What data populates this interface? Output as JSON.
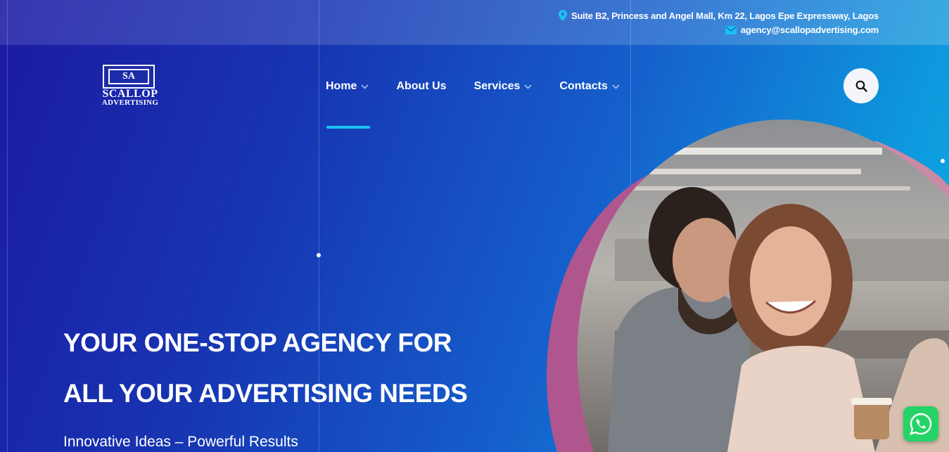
{
  "topbar": {
    "address": "Suite B2, Princess and Angel Mall, Km 22, Lagos Epe Expressway, Lagos",
    "email": "agency@scallopadvertising.com",
    "address_icon": "map-pin-icon",
    "email_icon": "envelope-icon"
  },
  "logo": {
    "line1": "SCALLOP",
    "line2": "ADVERTISING",
    "emblem": "SA"
  },
  "nav": {
    "items": [
      {
        "label": "Home",
        "has_dropdown": true,
        "active": true
      },
      {
        "label": "About Us",
        "has_dropdown": false
      },
      {
        "label": "Services",
        "has_dropdown": true
      },
      {
        "label": "Contacts",
        "has_dropdown": true
      }
    ],
    "search_icon": "search-icon"
  },
  "hero": {
    "title_line1": "YOUR ONE-STOP AGENCY FOR",
    "title_line2": "ALL YOUR ADVERTISING NEEDS",
    "subtitle": "Innovative Ideas – Powerful Results"
  },
  "colors": {
    "accent": "#1cc3f2",
    "gradient_start": "#1b1aa3",
    "gradient_end": "#0bb2e6",
    "blob_pink": "#b0568f",
    "whatsapp": "#25d366"
  },
  "floating": {
    "whatsapp_icon": "whatsapp-icon"
  }
}
